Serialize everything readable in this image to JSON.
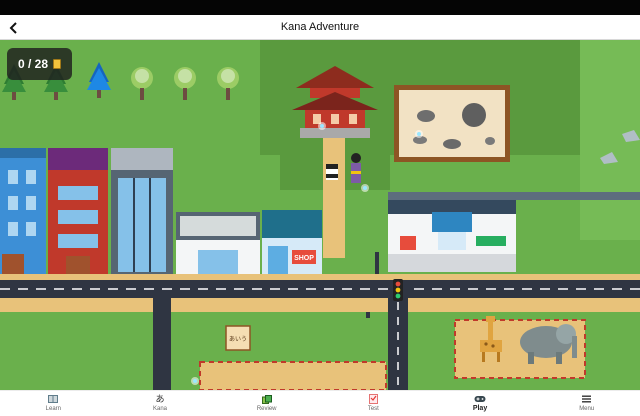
{
  "header": {
    "title": "Kana Adventure",
    "back_label": "‹"
  },
  "hud": {
    "progress_text": "0 / 28"
  },
  "map_labels": {
    "shop_sign": "SHOP",
    "scroll_text": "あいう"
  },
  "tabs": [
    {
      "label": "Learn",
      "icon": "book-icon",
      "glyph": "▰"
    },
    {
      "label": "Kana",
      "icon": "hiragana-a-icon",
      "glyph": "あ"
    },
    {
      "label": "Review",
      "icon": "cards-icon",
      "glyph": "▪"
    },
    {
      "label": "Test",
      "icon": "test-sheet-icon",
      "glyph": "✎"
    },
    {
      "label": "Play",
      "icon": "gamepad-icon",
      "glyph": "▬"
    },
    {
      "label": "Menu",
      "icon": "menu-icon",
      "glyph": "≡"
    }
  ],
  "active_tab": "Play",
  "colors": {
    "grass": "#6ab04c",
    "road": "#2f3542",
    "sand": "#e8c27a",
    "accent": "#c0392b"
  }
}
